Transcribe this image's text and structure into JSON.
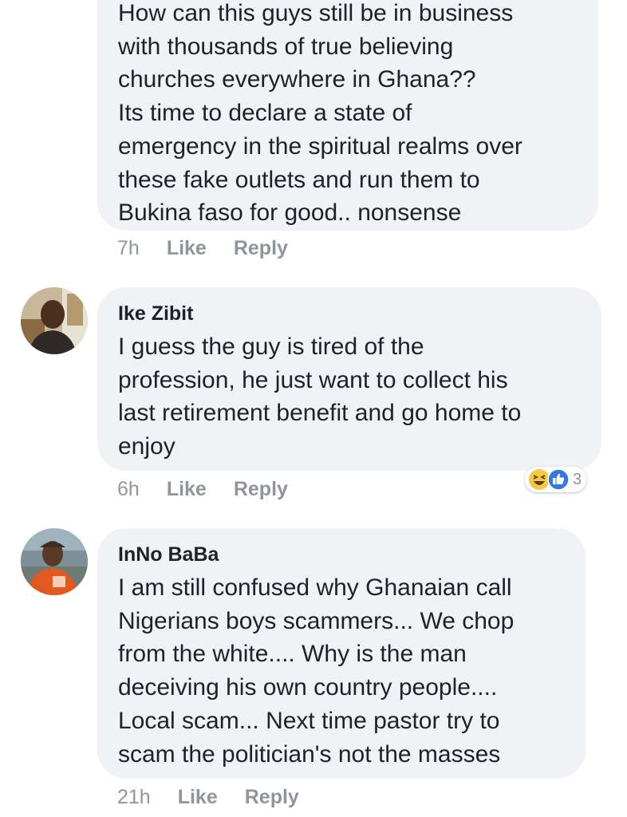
{
  "comments": [
    {
      "text": "How can this guys still be in business\nwith thousands of true believing\nchurches everywhere in Ghana??\nIts time to declare a state of\nemergency in the spiritual realms over\nthese fake outlets and run them to\nBukina faso for good.. nonsense",
      "time": "7h",
      "like_label": "Like",
      "reply_label": "Reply"
    },
    {
      "author": "Ike Zibit",
      "text": "I guess the guy is tired of the\nprofession, he just want to collect his\nlast retirement benefit and go home to\nenjoy",
      "time": "6h",
      "like_label": "Like",
      "reply_label": "Reply",
      "reactions": {
        "icons": [
          "haha-icon",
          "like-icon"
        ],
        "count": "3"
      }
    },
    {
      "author": "InNo BaBa",
      "text": "I am still confused why Ghanaian call\nNigerians boys scammers... We chop\nfrom the white.... Why is the man\ndeceiving his own country people....\nLocal scam... Next time pastor try to\nscam the politician's not the masses",
      "time": "21h",
      "like_label": "Like",
      "reply_label": "Reply"
    }
  ],
  "colors": {
    "bubble": "#f1f2f6",
    "text": "#1d2129",
    "meta": "#90949c",
    "like_blue": "#3578e5",
    "haha_yellow": "#f7c843"
  }
}
